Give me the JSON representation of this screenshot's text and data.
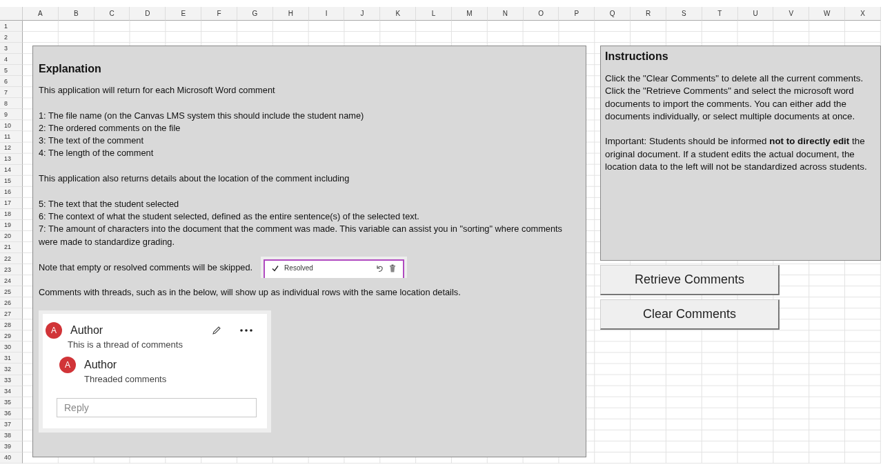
{
  "sheet": {
    "columns": [
      "A",
      "B",
      "C",
      "D",
      "E",
      "F",
      "G",
      "H",
      "I",
      "J",
      "K",
      "L",
      "M",
      "N",
      "O",
      "P",
      "Q",
      "R",
      "S",
      "T",
      "U",
      "V",
      "W",
      "X"
    ],
    "rows": [
      "1",
      "2",
      "3",
      "4",
      "5",
      "6",
      "7",
      "8",
      "9",
      "10",
      "11",
      "12",
      "13",
      "14",
      "15",
      "16",
      "17",
      "18",
      "19",
      "20",
      "21",
      "22",
      "23",
      "24",
      "25",
      "26",
      "27",
      "28",
      "29",
      "30",
      "31",
      "32",
      "33",
      "34",
      "35",
      "36",
      "37",
      "38",
      "39",
      "40"
    ]
  },
  "explanation": {
    "title": "Explanation",
    "blocks": [
      {
        "kind": "text",
        "lines": [
          "This application will return for each Microsoft Word comment"
        ]
      },
      {
        "kind": "text",
        "lines": [
          "1: The file name (on the Canvas LMS system this should include the student name)",
          "2: The ordered comments on the file",
          "3: The text of the comment",
          "4: The length of the comment"
        ]
      },
      {
        "kind": "text",
        "lines": [
          "This application also returns details about the location of the comment including"
        ]
      },
      {
        "kind": "text",
        "lines": [
          "5: The text that the student selected",
          "6: The context of what the student selected, defined as the entire sentence(s) of the selected text.",
          "7: The amount of characters into the document that the comment was made. This variable can assist you in \"sorting\" where comments were made to standardize grading."
        ]
      },
      {
        "kind": "resolved_note",
        "text": "Note that empty or resolved comments will be skipped.",
        "label": "Resolved"
      },
      {
        "kind": "text",
        "lines": [
          "Comments with threads, such as in the below, will show up as individual rows with the same location details."
        ]
      },
      {
        "kind": "thread",
        "comment": {
          "avatar": "A",
          "author": "Author",
          "text": "This is a thread of comments",
          "replies": [
            {
              "avatar": "A",
              "author": "Author",
              "text": "Threaded comments"
            }
          ]
        },
        "reply": {
          "placeholder": "Reply"
        }
      }
    ]
  },
  "instructions": {
    "title": "Instructions",
    "paragraphs": [
      [
        "Click the \"Clear Comments\" to delete all the current comments.",
        "Click the \"Retrieve Comments\" and select the microsoft word documents to import the comments. You can either add the documents individually, or select multiple documents at once."
      ],
      [
        "Important: Students should be informed **not to directly edit** the original document. If  a student edits the actual document, the location data to the left will not be standardized across students."
      ]
    ]
  },
  "buttons": [
    "Retrieve Comments",
    "Clear Comments"
  ]
}
